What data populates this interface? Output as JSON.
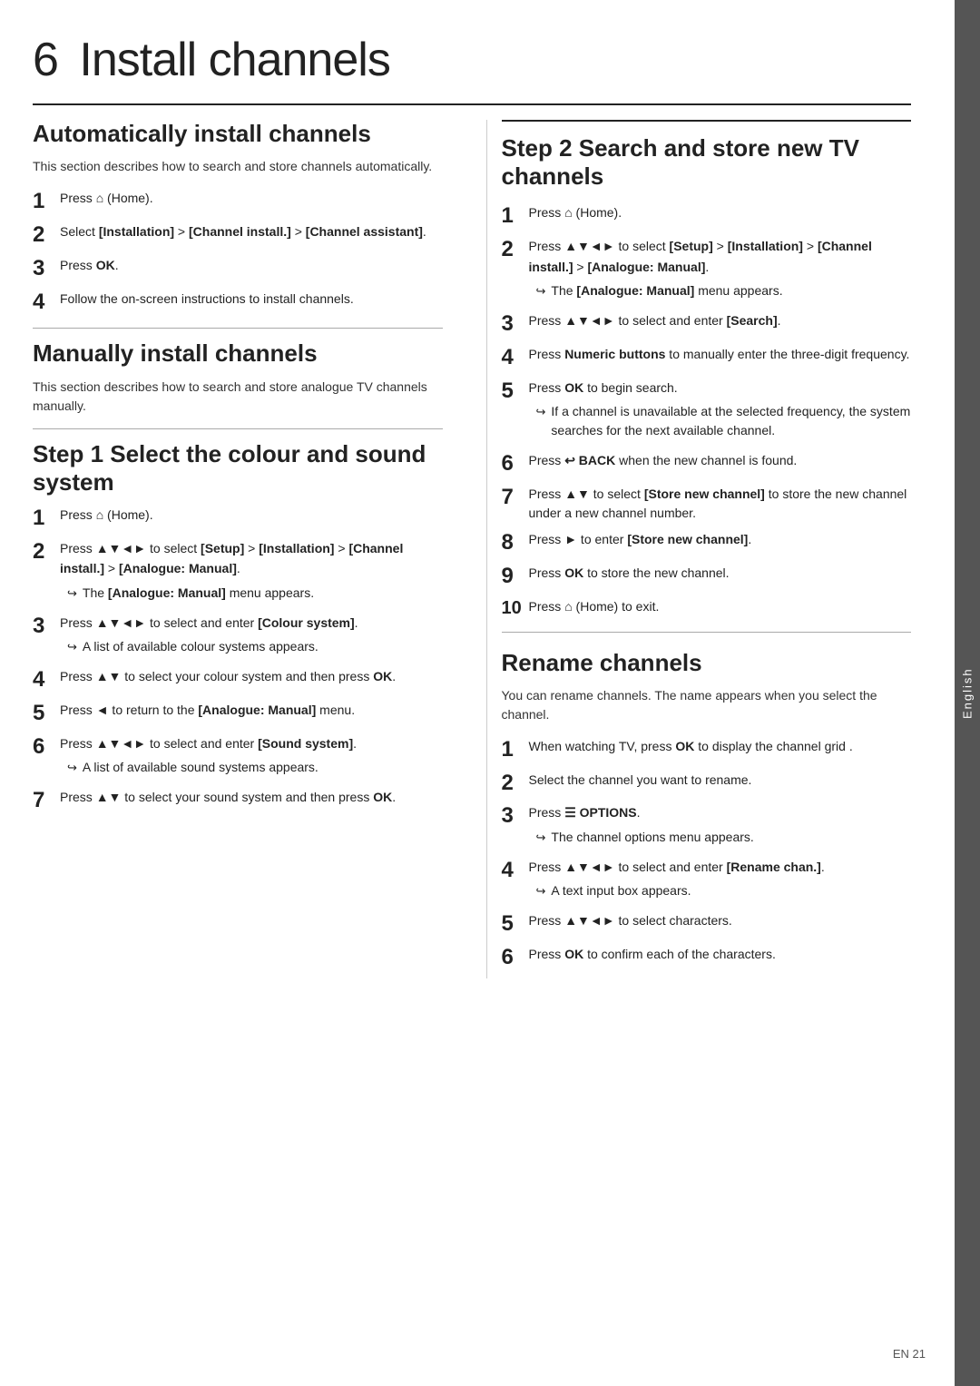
{
  "page": {
    "chapter_num": "6",
    "chapter_title": "Install channels",
    "sidebar_label": "English",
    "footer_text": "EN  21"
  },
  "left_col": {
    "auto_section": {
      "title": "Automatically install channels",
      "desc": "This section describes how to search and store channels automatically.",
      "steps": [
        {
          "num": "1",
          "text": "Press",
          "icon": "home",
          "label": "(Home)."
        },
        {
          "num": "2",
          "text": "Select [Installation] > [Channel install.] > [Channel assistant]."
        },
        {
          "num": "3",
          "text": "Press OK."
        },
        {
          "num": "4",
          "text": "Follow the on-screen instructions to install channels."
        }
      ]
    },
    "manual_section": {
      "title": "Manually install channels",
      "desc": "This section describes how to search and store analogue TV channels manually."
    },
    "step1_section": {
      "title": "Step 1 Select the colour and sound system",
      "steps": [
        {
          "num": "1",
          "text": "Press",
          "icon": "home",
          "label": "(Home)."
        },
        {
          "num": "2",
          "text": "Press ▲▼◄► to select [Setup] > [Installation] > [Channel install.] > [Analogue: Manual].",
          "note": "The [Analogue: Manual] menu appears."
        },
        {
          "num": "3",
          "text": "Press ▲▼◄► to select and enter [Colour system].",
          "note": "A list of available colour systems appears."
        },
        {
          "num": "4",
          "text": "Press ▲▼ to select your colour system and then press OK."
        },
        {
          "num": "5",
          "text": "Press ◄ to return to the [Analogue: Manual] menu."
        },
        {
          "num": "6",
          "text": "Press ▲▼◄► to select and enter [Sound system].",
          "note": "A list of available sound systems appears."
        },
        {
          "num": "7",
          "text": "Press ▲▼ to select your sound system and then press OK."
        }
      ]
    }
  },
  "right_col": {
    "step2_section": {
      "title": "Step 2 Search and store new TV channels",
      "steps": [
        {
          "num": "1",
          "text": "Press",
          "icon": "home",
          "label": "(Home)."
        },
        {
          "num": "2",
          "text": "Press ▲▼◄► to select [Setup] > [Installation] > [Channel install.] > [Analogue: Manual].",
          "note": "The [Analogue: Manual] menu appears."
        },
        {
          "num": "3",
          "text": "Press ▲▼◄► to select and enter [Search]."
        },
        {
          "num": "4",
          "text": "Press Numeric buttons to manually enter the three-digit frequency."
        },
        {
          "num": "5",
          "text": "Press OK to begin search.",
          "note": "If a channel is unavailable at the selected frequency, the system searches for the next available channel."
        },
        {
          "num": "6",
          "text": "Press ↩ BACK when the new channel is found."
        },
        {
          "num": "7",
          "text": "Press ▲▼ to select [Store new channel] to store the new channel under a new channel number."
        },
        {
          "num": "8",
          "text": "Press ► to enter [Store new channel]."
        },
        {
          "num": "9",
          "text": "Press OK to store the new channel."
        },
        {
          "num": "10",
          "text": "Press",
          "icon": "home",
          "label": "(Home) to exit."
        }
      ]
    },
    "rename_section": {
      "title": "Rename channels",
      "desc": "You can rename channels. The name appears when you select the channel.",
      "steps": [
        {
          "num": "1",
          "text": "When watching TV, press OK to display the channel grid ."
        },
        {
          "num": "2",
          "text": "Select the channel you want to rename."
        },
        {
          "num": "3",
          "text": "Press ☰ OPTIONS.",
          "note": "The channel options menu appears."
        },
        {
          "num": "4",
          "text": "Press ▲▼◄► to select and enter [Rename chan.].",
          "note": "A text input box appears."
        },
        {
          "num": "5",
          "text": "Press ▲▼◄► to select characters."
        },
        {
          "num": "6",
          "text": "Press OK to confirm each of the characters."
        }
      ]
    }
  }
}
